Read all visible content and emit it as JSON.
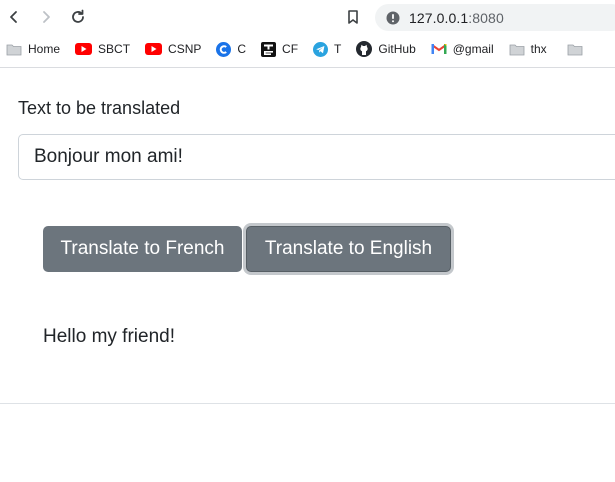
{
  "browser": {
    "url_host": "127.0.0.1",
    "url_port": ":8080",
    "bookmarks": [
      {
        "label": "Home",
        "icon": "folder-icon"
      },
      {
        "label": "SBCT",
        "icon": "youtube-icon"
      },
      {
        "label": "CSNP",
        "icon": "youtube-icon"
      },
      {
        "label": "C",
        "icon": "c-logo-icon"
      },
      {
        "label": "CF",
        "icon": "cf-logo-icon"
      },
      {
        "label": "T",
        "icon": "telegram-icon"
      },
      {
        "label": "GitHub",
        "icon": "github-icon"
      },
      {
        "label": "@gmail",
        "icon": "gmail-icon"
      },
      {
        "label": "thx",
        "icon": "folder-icon"
      }
    ]
  },
  "form": {
    "label": "Text to be translated",
    "input_value": "Bonjour mon ami!",
    "btn_french": "Translate to French",
    "btn_english": "Translate to English",
    "result": "Hello my friend!"
  },
  "colors": {
    "button_bg": "#6c757d",
    "youtube_red": "#ff0000",
    "telegram_blue": "#2aa3df",
    "c_blue": "#1a73e8"
  }
}
